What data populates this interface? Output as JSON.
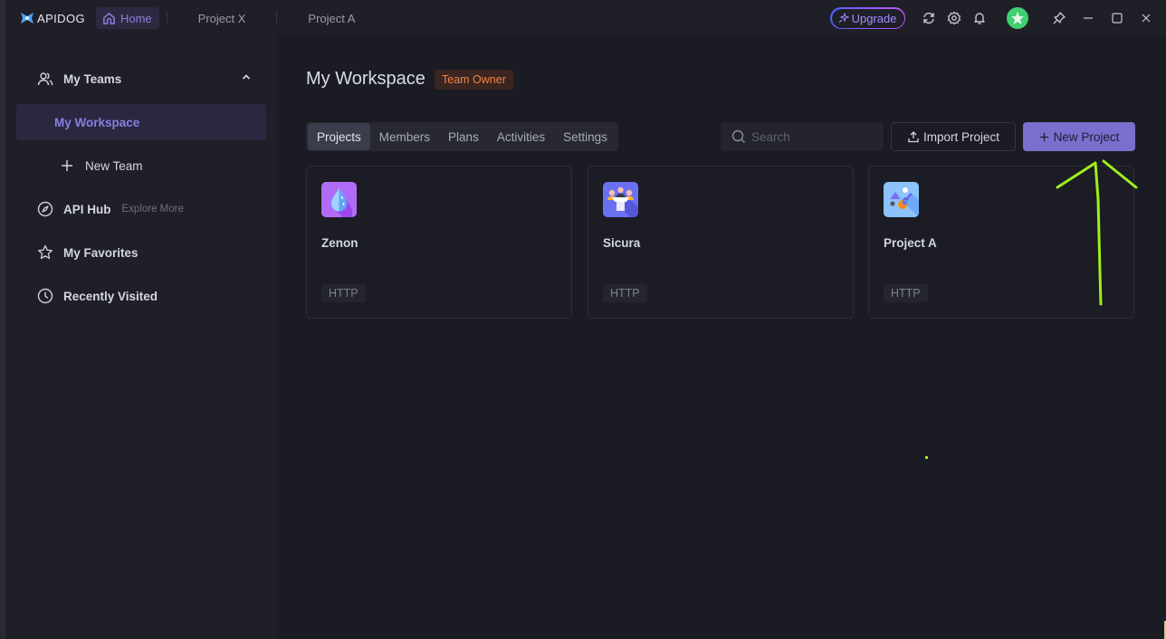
{
  "titlebar": {
    "logo_text": "APIDOG",
    "home_tab": "Home",
    "project_tabs": [
      "Project X",
      "Project A"
    ],
    "upgrade_label": "Upgrade",
    "icons": [
      "refresh-icon",
      "settings-icon",
      "bell-icon",
      "avatar",
      "pin-icon",
      "minimize-icon",
      "maximize-icon",
      "close-icon"
    ]
  },
  "sidebar": {
    "my_teams": "My Teams",
    "my_workspace": "My Workspace",
    "new_team": "New Team",
    "api_hub": "API Hub",
    "explore_more": "Explore More",
    "my_favorites": "My Favorites",
    "recently_visited": "Recently Visited"
  },
  "main": {
    "title": "My Workspace",
    "role_badge": "Team Owner",
    "tabs": [
      "Projects",
      "Members",
      "Plans",
      "Activities",
      "Settings"
    ],
    "active_tab": "Projects",
    "search_placeholder": "Search",
    "search_value": "",
    "import_label": "Import Project",
    "new_project_label": "New Project",
    "projects": [
      {
        "name": "Zenon",
        "type": "HTTP",
        "icon": "water-drop-icon"
      },
      {
        "name": "Sicura",
        "type": "HTTP",
        "icon": "team-podium-icon"
      },
      {
        "name": "Project A",
        "type": "HTTP",
        "icon": "shapes-icon"
      }
    ]
  },
  "colors": {
    "accent": "#7b6fce",
    "accent_text": "#8b7ee0",
    "badge_orange": "#f0824a",
    "annotation": "#9ef01a"
  }
}
